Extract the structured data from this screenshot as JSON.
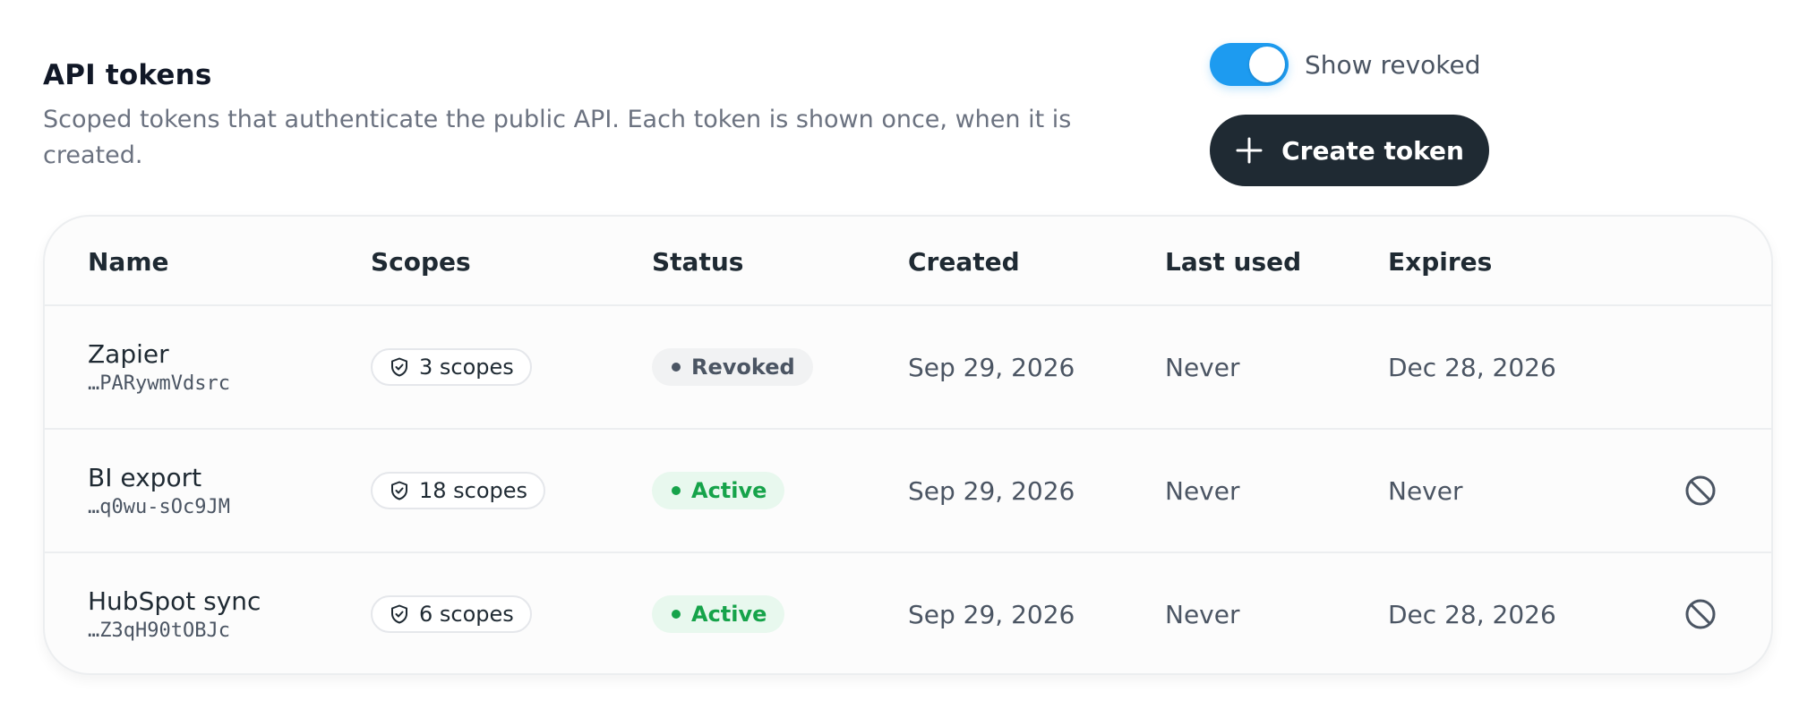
{
  "header": {
    "title": "API tokens",
    "description": "Scoped tokens that authenticate the public API. Each token is shown once, when it is created."
  },
  "controls": {
    "toggle_label": "Show revoked",
    "toggle_on": true,
    "create_label": "Create token"
  },
  "table": {
    "columns": [
      "Name",
      "Scopes",
      "Status",
      "Created",
      "Last used",
      "Expires"
    ],
    "rows": [
      {
        "name": "Zapier",
        "key": "…PARywmVdsrc",
        "scopes": "3 scopes",
        "status": "Revoked",
        "created": "Sep 29, 2026",
        "last_used": "Never",
        "expires": "Dec 28, 2026"
      },
      {
        "name": "BI export",
        "key": "…q0wu-sOc9JM",
        "scopes": "18 scopes",
        "status": "Active",
        "created": "Sep 29, 2026",
        "last_used": "Never",
        "expires": "Never"
      },
      {
        "name": "HubSpot sync",
        "key": "…Z3qH90tOBJc",
        "scopes": "6 scopes",
        "status": "Active",
        "created": "Sep 29, 2026",
        "last_used": "Never",
        "expires": "Dec 28, 2026"
      }
    ]
  },
  "icons": {
    "plus": "plus-icon",
    "scope": "shield-check-icon",
    "revoke": "ban-icon"
  },
  "colors": {
    "toggle_on": "#1d9bf0",
    "primary_button": "#1f2a33",
    "status_active": "#16a34a",
    "status_revoked": "#4b5563"
  }
}
